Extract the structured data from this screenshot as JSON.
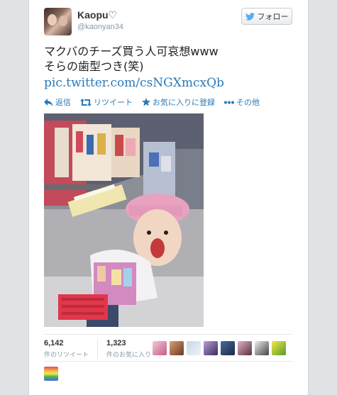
{
  "user": {
    "name": "Kaopu♡",
    "handle": "@kaonyan34"
  },
  "follow_button": {
    "label": "フォロー"
  },
  "tweet": {
    "line1": "マクバのチーズ買う人可哀想www",
    "line2": "そらの歯型つき(笑)",
    "link": "pic.twitter.com/csNGXmcxQb"
  },
  "actions": [
    {
      "label": "返信",
      "icon": "reply-icon"
    },
    {
      "label": "リツイート",
      "icon": "retweet-icon"
    },
    {
      "label": "お気に入りに登録",
      "icon": "star-icon"
    },
    {
      "label": "その他",
      "icon": "more-icon"
    }
  ],
  "stats": {
    "retweets": {
      "count": "6,142",
      "label": "件のリツイート"
    },
    "favorites": {
      "count": "1,323",
      "label": "件のお気に入り"
    }
  },
  "colors": {
    "link": "#2a7ab8",
    "page_bg": "#dfe3e6",
    "twitter_blue": "#55acee"
  }
}
